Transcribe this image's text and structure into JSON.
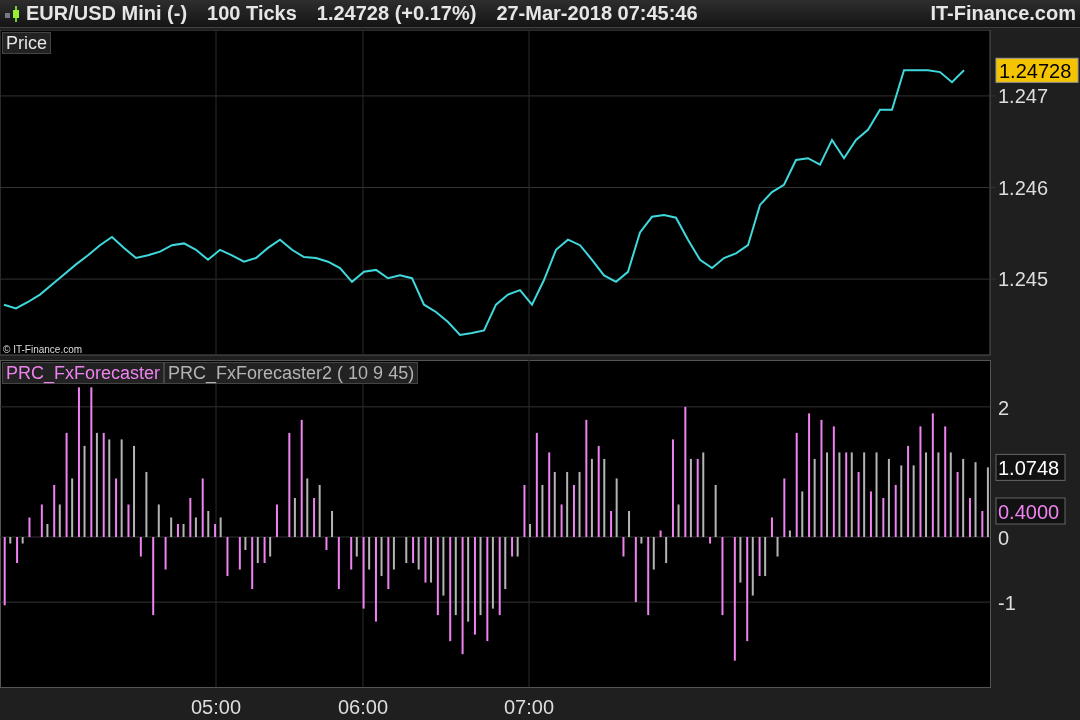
{
  "header": {
    "instrument": "EUR/USD Mini (-)",
    "period": "100 Ticks",
    "quote": "1.24728 (+0.17%)",
    "datetime": "27-Mar-2018 07:45:46",
    "brand": "IT-Finance.com"
  },
  "price_panel": {
    "copyright": "© IT-Finance.com",
    "last_value": "1.24728",
    "chart_data": {
      "type": "line",
      "grid": true,
      "ylim": [
        1.24416,
        1.24772
      ],
      "yticks": [
        {
          "value": 1.245,
          "label": "1.245"
        },
        {
          "value": 1.246,
          "label": "1.246"
        },
        {
          "value": 1.247,
          "label": "1.247"
        }
      ],
      "series": [
        {
          "name": "Price",
          "color": "#3fd8dc",
          "values": [
            1.24472,
            1.24468,
            1.24475,
            1.24483,
            1.24494,
            1.24505,
            1.24516,
            1.24526,
            1.24537,
            1.24546,
            1.24534,
            1.24523,
            1.24526,
            1.2453,
            1.24537,
            1.24539,
            1.24532,
            1.24521,
            1.24532,
            1.24526,
            1.24519,
            1.24523,
            1.24534,
            1.24543,
            1.24532,
            1.24524,
            1.24523,
            1.24519,
            1.24512,
            1.24497,
            1.24508,
            1.2451,
            1.24501,
            1.24504,
            1.24501,
            1.24472,
            1.24464,
            1.24453,
            1.24439,
            1.24441,
            1.24444,
            1.24472,
            1.24483,
            1.24488,
            1.24472,
            1.24499,
            1.24532,
            1.24543,
            1.24537,
            1.24521,
            1.24504,
            1.24497,
            1.24508,
            1.24551,
            1.24568,
            1.2457,
            1.24567,
            1.24543,
            1.24521,
            1.24512,
            1.24523,
            1.24528,
            1.24537,
            1.24581,
            1.24595,
            1.24603,
            1.2463,
            1.24632,
            1.24625,
            1.24652,
            1.24632,
            1.24652,
            1.24663,
            1.24685,
            1.24685,
            1.24728,
            1.24728,
            1.24728,
            1.24726,
            1.24715,
            1.24728
          ]
        }
      ]
    }
  },
  "indicator_panel": {
    "time_labels": [
      "05:00",
      "06:00",
      "07:00"
    ],
    "chart_data": {
      "type": "bar",
      "grid": true,
      "annotations": [
        "1.0748",
        "0.4000"
      ],
      "ylim": [
        -2.32,
        2.72
      ],
      "yticks": [
        {
          "value": 2,
          "label": "2"
        },
        {
          "value": 0,
          "label": "0"
        },
        {
          "value": -1,
          "label": "-1"
        }
      ],
      "series": [
        {
          "name": "PRC_FxForecaster",
          "color": "#ee82ee",
          "values": [
            -1.05,
            -0.4,
            0.3,
            0.5,
            0.8,
            1.6,
            2.3,
            2.3,
            1.6,
            0.9,
            0.5,
            -0.3,
            -1.2,
            -0.5,
            0.2,
            0.6,
            0.9,
            0.2,
            -0.6,
            -0.5,
            -0.8,
            -0.4,
            0.5,
            1.6,
            1.8,
            0.6,
            -0.2,
            -0.8,
            -0.5,
            -1.1,
            -1.3,
            -0.8,
            0.0,
            -0.4,
            -0.7,
            -1.2,
            -1.6,
            -1.8,
            -1.5,
            -1.6,
            -1.2,
            -0.3,
            0.8,
            1.6,
            1.3,
            0.5,
            0.8,
            1.8,
            1.4,
            0.4,
            -0.3,
            -1.0,
            -1.2,
            0.1,
            1.5,
            2.0,
            1.2,
            -0.1,
            -1.2,
            -1.9,
            -1.6,
            -0.6,
            0.3,
            0.9,
            1.6,
            1.9,
            1.8,
            1.7,
            1.3,
            1.0,
            0.7,
            0.6,
            0.8,
            1.4,
            1.7,
            1.9,
            1.7,
            1.0,
            0.6,
            0.4
          ]
        },
        {
          "name": "PRC_FxForecaster2 ( 10 9 45)",
          "color": "#b4b4b4",
          "values": [
            -0.1,
            -0.1,
            0.0,
            0.2,
            0.5,
            0.9,
            1.4,
            1.6,
            1.5,
            1.5,
            1.4,
            1.0,
            0.5,
            0.3,
            0.2,
            0.3,
            0.4,
            0.3,
            0.0,
            -0.2,
            -0.4,
            -0.3,
            0.0,
            0.6,
            0.9,
            0.8,
            0.4,
            0.0,
            -0.3,
            -0.5,
            -0.6,
            -0.5,
            -0.4,
            -0.5,
            -0.7,
            -0.9,
            -1.2,
            -1.3,
            -1.2,
            -1.1,
            -0.8,
            -0.3,
            0.2,
            0.8,
            1.0,
            1.0,
            1.0,
            1.2,
            1.2,
            0.9,
            0.4,
            -0.1,
            -0.5,
            -0.4,
            0.5,
            1.2,
            1.3,
            0.8,
            0.0,
            -0.7,
            -0.9,
            -0.6,
            -0.3,
            0.1,
            0.7,
            1.2,
            1.3,
            1.3,
            1.3,
            1.3,
            1.3,
            1.2,
            1.1,
            1.1,
            1.3,
            1.3,
            1.3,
            1.2,
            1.15,
            1.07
          ]
        }
      ]
    }
  }
}
